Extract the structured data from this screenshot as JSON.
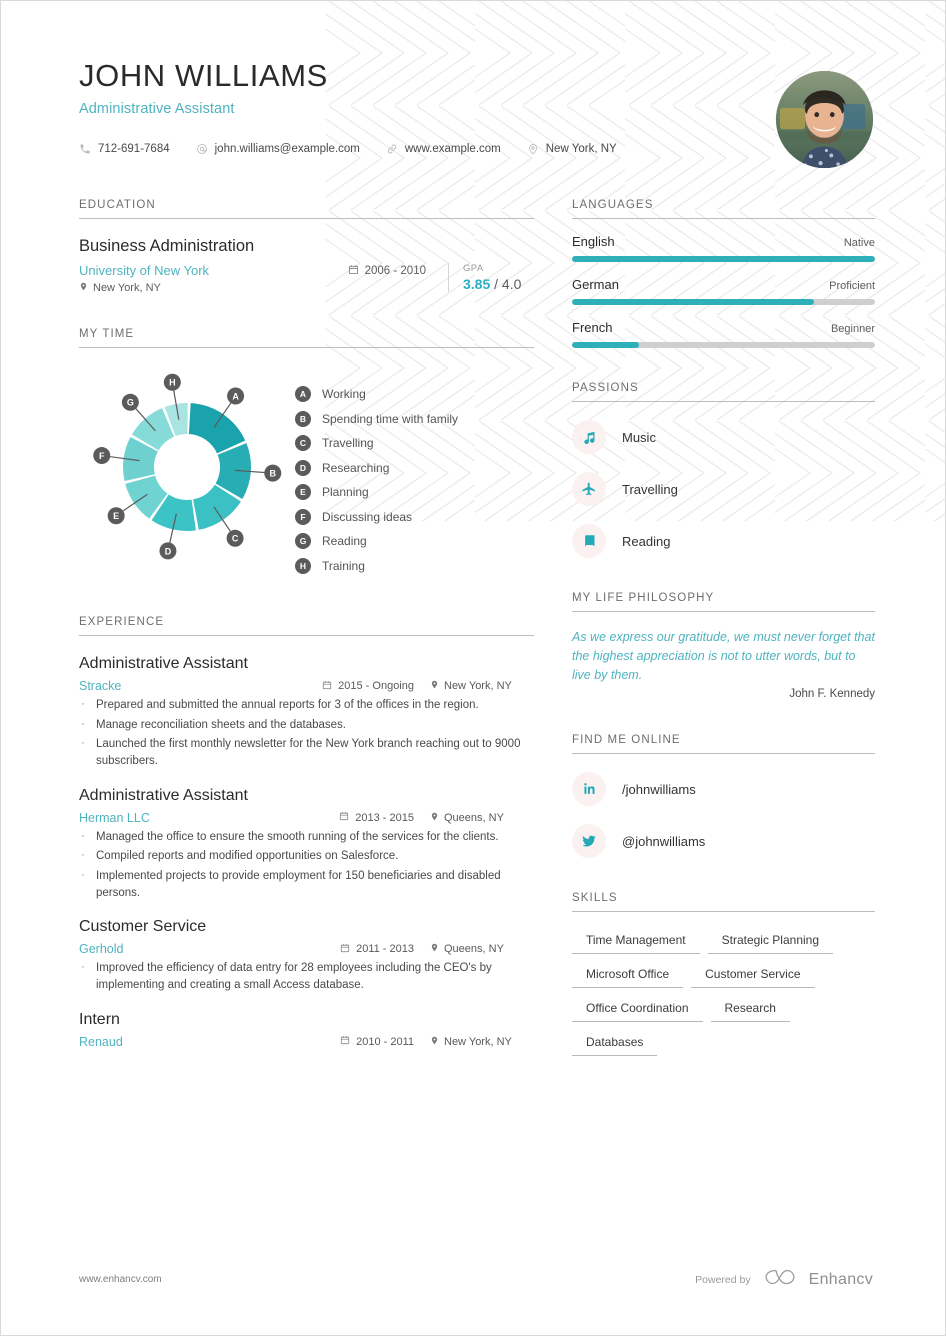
{
  "header": {
    "name": "JOHN WILLIAMS",
    "job_title": "Administrative Assistant",
    "contacts": [
      {
        "icon": "phone-icon",
        "value": "712-691-7684"
      },
      {
        "icon": "email-icon",
        "value": "john.williams@example.com"
      },
      {
        "icon": "link-icon",
        "value": "www.example.com"
      },
      {
        "icon": "location-icon",
        "value": "New York, NY"
      }
    ],
    "photo_alt": "profile-photo"
  },
  "education": {
    "title": "EDUCATION",
    "entries": [
      {
        "degree": "Business Administration",
        "school": "University of New York",
        "location": "New York, NY",
        "date": "2006 - 2010",
        "gpa_label": "GPA",
        "gpa_value": "3.85",
        "gpa_scale": "/ 4.0"
      }
    ]
  },
  "my_time": {
    "title": "MY TIME",
    "legend": [
      {
        "key": "A",
        "label": "Working"
      },
      {
        "key": "B",
        "label": "Spending time with family"
      },
      {
        "key": "C",
        "label": "Travelling"
      },
      {
        "key": "D",
        "label": "Researching"
      },
      {
        "key": "E",
        "label": "Planning"
      },
      {
        "key": "F",
        "label": "Discussing ideas"
      },
      {
        "key": "G",
        "label": "Reading"
      },
      {
        "key": "H",
        "label": "Training"
      }
    ]
  },
  "chart_data": {
    "type": "pie",
    "title": "MY TIME",
    "labels": [
      "Working",
      "Spending time with family",
      "Travelling",
      "Researching",
      "Planning",
      "Discussing ideas",
      "Reading",
      "Training"
    ],
    "keys": [
      "A",
      "B",
      "C",
      "D",
      "E",
      "F",
      "G",
      "H"
    ],
    "values": [
      63,
      53,
      48,
      43,
      40,
      42,
      38,
      23
    ],
    "unit": "degrees",
    "colors": [
      "#1aa3ad",
      "#28adb4",
      "#3bc0c4",
      "#3cc3c6",
      "#6fd3d2",
      "#6fd0d0",
      "#86dbd9",
      "#a8e5e2"
    ],
    "legend_position": "right",
    "donut": true,
    "inner_radius_ratio": 0.52
  },
  "experience": {
    "title": "EXPERIENCE",
    "entries": [
      {
        "role": "Administrative Assistant",
        "company": "Stracke",
        "date": "2015 - Ongoing",
        "location": "New York, NY",
        "bullets": [
          "Prepared and submitted the annual reports for 3 of the offices in the region.",
          "Manage reconciliation sheets and the databases.",
          "Launched the first monthly newsletter for the New York branch reaching out to 9000 subscribers."
        ]
      },
      {
        "role": "Administrative Assistant",
        "company": "Herman LLC",
        "date": "2013 - 2015",
        "location": "Queens, NY",
        "bullets": [
          "Managed the office to ensure the smooth running of the services for the clients.",
          "Compiled reports and modified opportunities on Salesforce.",
          "Implemented projects to provide employment for 150 beneficiaries and disabled persons."
        ]
      },
      {
        "role": "Customer Service",
        "company": "Gerhold",
        "date": "2011 - 2013",
        "location": "Queens, NY",
        "bullets": [
          "Improved the efficiency of data entry for 28 employees including the CEO's by implementing and creating a small Access database."
        ]
      },
      {
        "role": "Intern",
        "company": "Renaud",
        "date": "2010 - 2011",
        "location": "New York, NY",
        "bullets": []
      }
    ]
  },
  "languages": {
    "title": "LANGUAGES",
    "items": [
      {
        "name": "English",
        "level": "Native",
        "percent": 100
      },
      {
        "name": "German",
        "level": "Proficient",
        "percent": 80
      },
      {
        "name": "French",
        "level": "Beginner",
        "percent": 22
      }
    ]
  },
  "passions": {
    "title": "PASSIONS",
    "items": [
      {
        "icon": "music-note-icon",
        "label": "Music"
      },
      {
        "icon": "airplane-icon",
        "label": "Travelling"
      },
      {
        "icon": "book-icon",
        "label": "Reading"
      }
    ]
  },
  "philosophy": {
    "title": "MY LIFE PHILOSOPHY",
    "quote": "As we express our gratitude, we must never forget that the highest appreciation is not to utter words, but to live by them.",
    "author": "John F. Kennedy"
  },
  "find_me_online": {
    "title": "FIND ME ONLINE",
    "items": [
      {
        "icon": "linkedin-icon",
        "label": "/johnwilliams"
      },
      {
        "icon": "twitter-icon",
        "label": "@johnwilliams"
      }
    ]
  },
  "skills": {
    "title": "SKILLS",
    "items": [
      "Time Management",
      "Strategic Planning",
      "Microsoft Office",
      "Customer Service",
      "Office Coordination",
      "Research",
      "Databases"
    ]
  },
  "footer": {
    "url": "www.enhancv.com",
    "powered_by": "Powered by",
    "brand": "Enhancv"
  },
  "colors": {
    "accent": "#4fb3bf",
    "accent_strong": "#29b0c0",
    "text": "#2b2b2b",
    "muted": "#6e6e6e",
    "rule": "#bdbdbd"
  }
}
